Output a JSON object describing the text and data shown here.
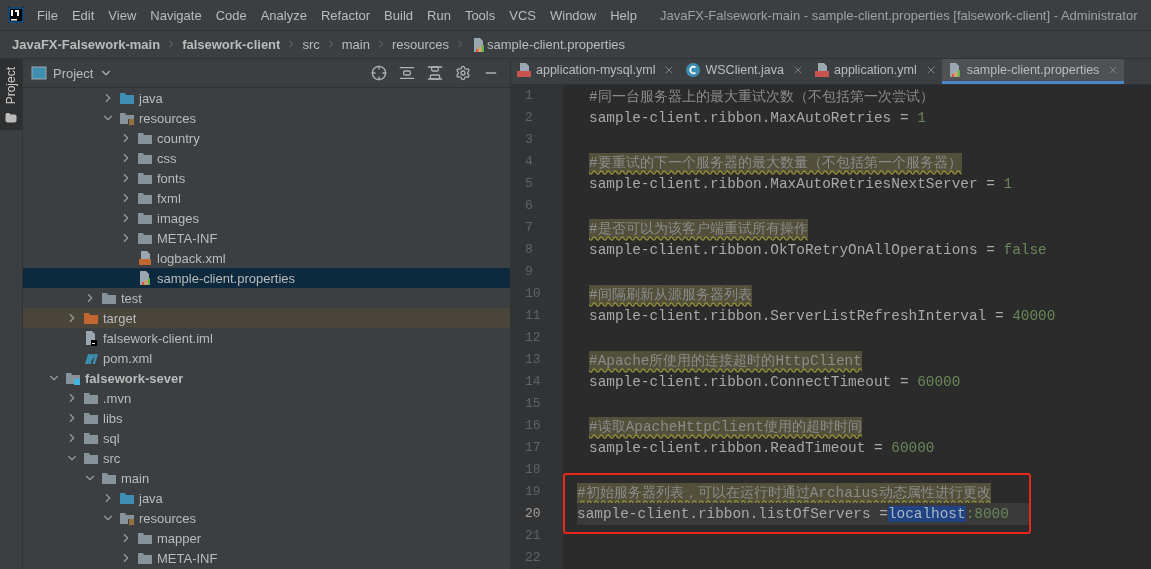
{
  "window": {
    "title": "JavaFX-Falsework-main - sample-client.properties [falsework-client] - Administrator"
  },
  "menu": [
    "File",
    "Edit",
    "View",
    "Navigate",
    "Code",
    "Analyze",
    "Refactor",
    "Build",
    "Run",
    "Tools",
    "VCS",
    "Window",
    "Help"
  ],
  "breadcrumbs": [
    {
      "label": "JavaFX-Falsework-main",
      "kind": "project"
    },
    {
      "label": "falsework-client",
      "kind": "module"
    },
    {
      "label": "src",
      "kind": "folder"
    },
    {
      "label": "main",
      "kind": "folder"
    },
    {
      "label": "resources",
      "kind": "folder"
    },
    {
      "label": "sample-client.properties",
      "kind": "properties"
    }
  ],
  "side_tab": {
    "label": "Project"
  },
  "project_panel": {
    "title": "Project"
  },
  "tree": [
    {
      "children": [
        {
          "children": [
            {
              "children": [
                {
                  "label": "java",
                  "kind": "source-folder",
                  "expanded": false,
                  "selected": false
                },
                {
                  "label": "resources",
                  "kind": "resources-folder",
                  "expanded": true,
                  "selected": false,
                  "children": [
                    {
                      "label": "country",
                      "kind": "folder",
                      "expanded": false,
                      "selected": false
                    },
                    {
                      "label": "css",
                      "kind": "folder",
                      "expanded": false,
                      "selected": false
                    },
                    {
                      "label": "fonts",
                      "kind": "folder",
                      "expanded": false,
                      "selected": false
                    },
                    {
                      "label": "fxml",
                      "kind": "folder",
                      "expanded": false,
                      "selected": false
                    },
                    {
                      "label": "images",
                      "kind": "folder",
                      "expanded": false,
                      "selected": false
                    },
                    {
                      "label": "META-INF",
                      "kind": "folder",
                      "expanded": false,
                      "selected": false
                    },
                    {
                      "label": "logback.xml",
                      "kind": "xml",
                      "selected": false
                    },
                    {
                      "label": "sample-client.properties",
                      "kind": "properties",
                      "selected": true
                    }
                  ]
                }
              ]
            },
            {
              "label": "test",
              "kind": "folder",
              "expanded": false,
              "selected": false
            }
          ]
        },
        {
          "label": "target",
          "kind": "excluded-folder",
          "expanded": false,
          "selected": false
        },
        {
          "label": "falsework-client.iml",
          "kind": "iml",
          "selected": false
        },
        {
          "label": "pom.xml",
          "kind": "maven",
          "selected": false
        }
      ]
    },
    {
      "label": "falsework-sever",
      "kind": "module",
      "expanded": true,
      "selected": false,
      "children": [
        {
          "label": ".mvn",
          "kind": "folder",
          "expanded": false,
          "selected": false
        },
        {
          "label": "libs",
          "kind": "folder",
          "expanded": false,
          "selected": false
        },
        {
          "label": "sql",
          "kind": "folder",
          "expanded": false,
          "selected": false
        },
        {
          "label": "src",
          "kind": "folder",
          "expanded": true,
          "selected": false,
          "children": [
            {
              "label": "main",
              "kind": "folder",
              "expanded": true,
              "selected": false,
              "children": [
                {
                  "label": "java",
                  "kind": "source-folder",
                  "expanded": false,
                  "selected": false
                },
                {
                  "label": "resources",
                  "kind": "resources-folder",
                  "expanded": true,
                  "selected": false,
                  "children": [
                    {
                      "label": "mapper",
                      "kind": "folder",
                      "expanded": false,
                      "selected": false
                    },
                    {
                      "label": "META-INF",
                      "kind": "folder",
                      "expanded": false,
                      "selected": false
                    }
                  ]
                }
              ]
            }
          ]
        }
      ]
    }
  ],
  "tabs": [
    {
      "label": "application-mysql.yml",
      "kind": "yml",
      "selected": false
    },
    {
      "label": "WSClient.java",
      "kind": "java-class",
      "selected": false
    },
    {
      "label": "application.yml",
      "kind": "yml",
      "selected": false
    },
    {
      "label": "sample-client.properties",
      "kind": "properties",
      "selected": true
    }
  ],
  "lines": [
    {
      "number": "1",
      "kind": "comment",
      "text": "#同一台服务器上的最大重试次数（不包括第一次尝试）",
      "warning": false,
      "current": false,
      "boxed": false
    },
    {
      "number": "2",
      "kind": "property",
      "key": "sample-client.ribbon.MaxAutoRetries = ",
      "value": [
        {
          "text": "1",
          "selected": false
        }
      ],
      "current": false,
      "boxed": false
    },
    {
      "number": "3",
      "kind": "blank",
      "current": false,
      "boxed": false
    },
    {
      "number": "4",
      "kind": "comment",
      "text": "#要重试的下一个服务器的最大数量（不包括第一个服务器）",
      "warning": true,
      "current": false,
      "boxed": false
    },
    {
      "number": "5",
      "kind": "property",
      "key": "sample-client.ribbon.MaxAutoRetriesNextServer = ",
      "value": [
        {
          "text": "1",
          "selected": false
        }
      ],
      "current": false,
      "boxed": false
    },
    {
      "number": "6",
      "kind": "blank",
      "current": false,
      "boxed": false
    },
    {
      "number": "7",
      "kind": "comment",
      "text": "#是否可以为该客户端重试所有操作",
      "warning": true,
      "current": false,
      "boxed": false
    },
    {
      "number": "8",
      "kind": "property",
      "key": "sample-client.ribbon.OkToRetryOnAllOperations = ",
      "value": [
        {
          "text": "false",
          "selected": false
        }
      ],
      "current": false,
      "boxed": false
    },
    {
      "number": "9",
      "kind": "blank",
      "current": false,
      "boxed": false
    },
    {
      "number": "10",
      "kind": "comment",
      "text": "#间隔刷新从源服务器列表",
      "warning": true,
      "current": false,
      "boxed": false
    },
    {
      "number": "11",
      "kind": "property",
      "key": "sample-client.ribbon.ServerListRefreshInterval = ",
      "value": [
        {
          "text": "40000",
          "selected": false
        }
      ],
      "current": false,
      "boxed": false
    },
    {
      "number": "12",
      "kind": "blank",
      "current": false,
      "boxed": false
    },
    {
      "number": "13",
      "kind": "comment",
      "text": "#Apache所使用的连接超时的HttpClient",
      "warning": true,
      "current": false,
      "boxed": false
    },
    {
      "number": "14",
      "kind": "property",
      "key": "sample-client.ribbon.ConnectTimeout = ",
      "value": [
        {
          "text": "60000",
          "selected": false
        }
      ],
      "current": false,
      "boxed": false
    },
    {
      "number": "15",
      "kind": "blank",
      "current": false,
      "boxed": false
    },
    {
      "number": "16",
      "kind": "comment",
      "text": "#读取ApacheHttpClient使用的超时时间",
      "warning": true,
      "current": false,
      "boxed": false
    },
    {
      "number": "17",
      "kind": "property",
      "key": "sample-client.ribbon.ReadTimeout = ",
      "value": [
        {
          "text": "60000",
          "selected": false
        }
      ],
      "current": false,
      "boxed": false
    },
    {
      "number": "18",
      "kind": "blank",
      "current": false,
      "boxed": false
    },
    {
      "number": "19",
      "kind": "comment",
      "text": "#初始服务器列表，可以在运行时通过Archaius动态属性进行更改",
      "warning": true,
      "current": false,
      "boxed": true
    },
    {
      "number": "20",
      "kind": "property",
      "key": "sample-client.ribbon.listOfServers =",
      "value": [
        {
          "text": "localhost",
          "selected": true
        },
        {
          "text": ":8000",
          "selected": false
        }
      ],
      "current": true,
      "boxed": true
    },
    {
      "number": "21",
      "kind": "blank",
      "current": false,
      "boxed": false
    },
    {
      "number": "22",
      "kind": "blank",
      "current": false,
      "boxed": false
    }
  ]
}
